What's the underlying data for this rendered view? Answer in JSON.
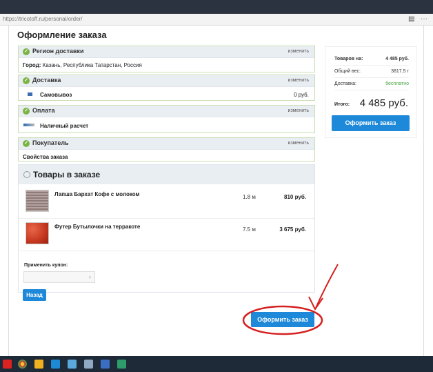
{
  "browser": {
    "url": "https://tricotoff.ru/personal/order/",
    "icons": [
      "reader-icon",
      "more-icon"
    ]
  },
  "page": {
    "title": "Оформление заказа"
  },
  "region": {
    "title": "Регион доставки",
    "edit": "изменить",
    "city_label": "Город:",
    "city_value": "Казань, Республика Татарстан, Россия"
  },
  "delivery": {
    "title": "Доставка",
    "edit": "изменить",
    "method": "Самовывоз",
    "price": "0 руб."
  },
  "payment": {
    "title": "Оплата",
    "edit": "изменить",
    "method": "Наличный расчет"
  },
  "buyer": {
    "title": "Покупатель",
    "edit": "изменить",
    "props": "Свойства заказа"
  },
  "goods": {
    "title": "Товары в заказе",
    "items": [
      {
        "name": "Лапша Бархат Кофе с молоком",
        "qty": "1.8 м",
        "price": "810 руб."
      },
      {
        "name": "Футер Бутылочки на терракоте",
        "qty": "7.5 м",
        "price": "3 675 руб."
      }
    ],
    "coupon_label": "Применить купон:",
    "back_label": "Назад"
  },
  "summary": {
    "goods_label": "Товаров на:",
    "goods_value": "4 485 руб.",
    "weight_label": "Общий вес:",
    "weight_value": "3817.5 г",
    "delivery_label": "Доставка:",
    "delivery_value": "бесплатно",
    "total_label": "Итого:",
    "total_value": "4 485 руб.",
    "order_label": "Оформить заказ"
  },
  "main_order_label": "Оформить заказ",
  "colors": {
    "accent": "#1e88d9",
    "annotation": "#d62020",
    "free": "#4ca643"
  }
}
